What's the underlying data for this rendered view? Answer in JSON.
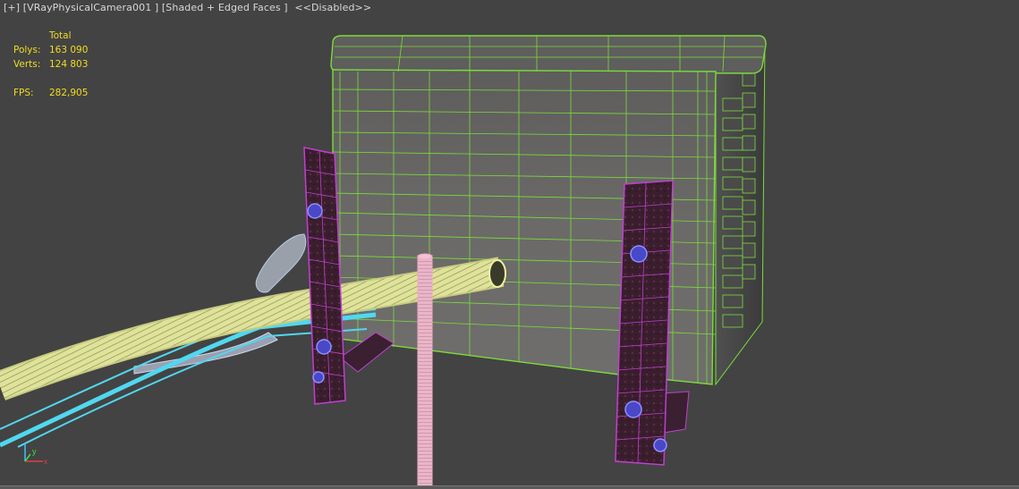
{
  "viewport": {
    "menu_plus": "[+]",
    "camera": "[VRayPhysicalCamera001 ]",
    "shading": "[Shaded + Edged Faces ]",
    "status": "<<Disabled>>"
  },
  "stats": {
    "header": "Total",
    "polys_label": "Polys:",
    "polys_value": "163 090",
    "verts_label": "Verts:",
    "verts_value": "124 803",
    "fps_label": "FPS:",
    "fps_value": "282,905"
  },
  "axis": {
    "x": "x",
    "y": "y",
    "z": "z"
  },
  "colors": {
    "background": "#434343",
    "stats_text": "#f0dd20",
    "box_wire": "#7cdc3a",
    "bracket_wire": "#c040d0",
    "hose_wire": "#f2f5a0",
    "cable_wire": "#50d8f0",
    "pipe_wire": "#f0a8c8",
    "bolt": "#5a5ae0"
  }
}
